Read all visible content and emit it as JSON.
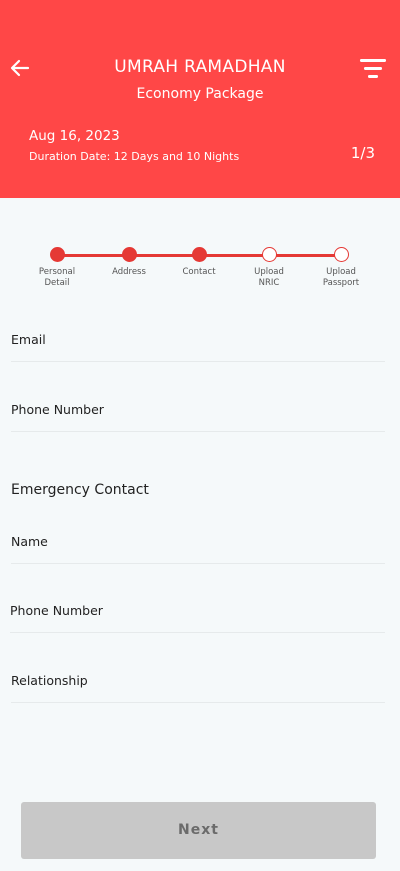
{
  "header": {
    "title": "UMRAH RAMADHAN",
    "subtitle": "Economy Package",
    "date": "Aug 16, 2023",
    "duration": "Duration Date: 12 Days and 10 Nights",
    "page_counter": "1/3",
    "back_icon": "arrow-left-icon",
    "filter_icon": "filter-icon",
    "color": "#ff4747"
  },
  "stepper": {
    "accent": "#e53935",
    "steps": [
      {
        "label": "Personal\nDetail",
        "completed": true
      },
      {
        "label": "Address",
        "completed": true
      },
      {
        "label": "Contact",
        "completed": true
      },
      {
        "label": "Upload\nNRIC",
        "completed": false
      },
      {
        "label": "Upload\nPassport",
        "completed": false
      }
    ]
  },
  "form": {
    "email_label": "Email",
    "phone_label": "Phone Number",
    "emergency_title": "Emergency Contact",
    "emergency_name_label": "Name",
    "emergency_phone_label": "Phone Number",
    "relationship_label": "Relationship"
  },
  "footer": {
    "next_label": "Next"
  }
}
